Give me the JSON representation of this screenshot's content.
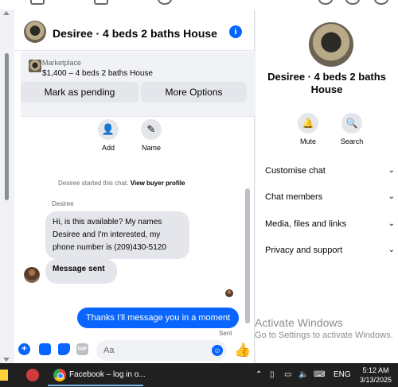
{
  "chat": {
    "title": "Desiree · 4 beds 2 baths House",
    "marketplace_label": "Marketplace",
    "listing": "$1,400 – 4 beds 2 baths House",
    "mark_pending": "Mark as pending",
    "more_options": "More Options",
    "actions": {
      "add": "Add",
      "name": "Name"
    },
    "system_msg_prefix": "Desiree started this chat.",
    "system_msg_link": "View buyer profile",
    "sender": "Desiree",
    "incoming_msg": "Hi, is this available? My names Desiree and I'm interested, my phone number is (209)430-5120",
    "message_sent": "Message sent",
    "outgoing_msg": "Thanks I'll message you in a moment",
    "sent_status": "Sent",
    "input_placeholder": "Aa",
    "gif_label": "GIF"
  },
  "panel": {
    "title": "Desiree · 4 beds 2 baths House",
    "mute": "Mute",
    "search": "Search",
    "sections": [
      "Customise chat",
      "Chat members",
      "Media, files and links",
      "Privacy and support"
    ]
  },
  "watermark": {
    "line1": "Activate Windows",
    "line2": "Go to Settings to activate Windows."
  },
  "taskbar": {
    "app_label": "Facebook – log in o...",
    "lang": "ENG",
    "time": "5:12 AM",
    "date": "3/13/2025"
  },
  "colors": {
    "accent": "#0866ff",
    "bubble_in": "#e4e6eb",
    "taskbar": "#202020"
  }
}
